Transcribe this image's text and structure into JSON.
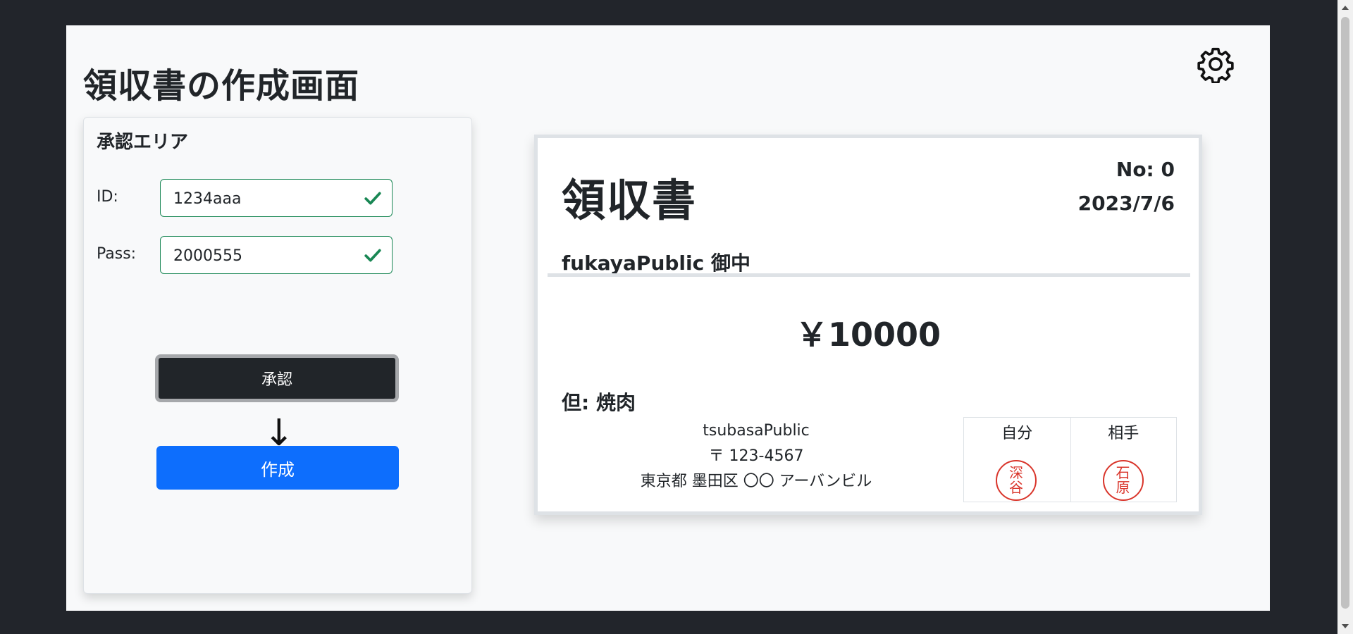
{
  "page": {
    "title": "領収書の作成画面"
  },
  "approval": {
    "title": "承認エリア",
    "id_label": "ID:",
    "id_value": "1234aaa",
    "pass_label": "Pass:",
    "pass_value": "2000555",
    "approve_label": "承認",
    "arrow": "↓",
    "create_label": "作成"
  },
  "receipt": {
    "title": "領収書",
    "no": "No: 0",
    "date": "2023/7/6",
    "recipient": "fukayaPublic 御中",
    "amount": "￥10000",
    "note": "但: 焼肉",
    "issuer_name": "tsubasaPublic",
    "issuer_postal": "〒 123-4567",
    "issuer_address": "東京都 墨田区 〇〇 アーバンビル",
    "stamps": [
      {
        "label": "自分",
        "seal_top": "深",
        "seal_bottom": "谷"
      },
      {
        "label": "相手",
        "seal_top": "石",
        "seal_bottom": "原"
      }
    ]
  },
  "icons": {
    "settings": "gear-icon",
    "valid": "check-icon"
  },
  "colors": {
    "primary": "#0d6efd",
    "dark": "#212529",
    "success": "#198754",
    "seal": "#d9352b"
  }
}
